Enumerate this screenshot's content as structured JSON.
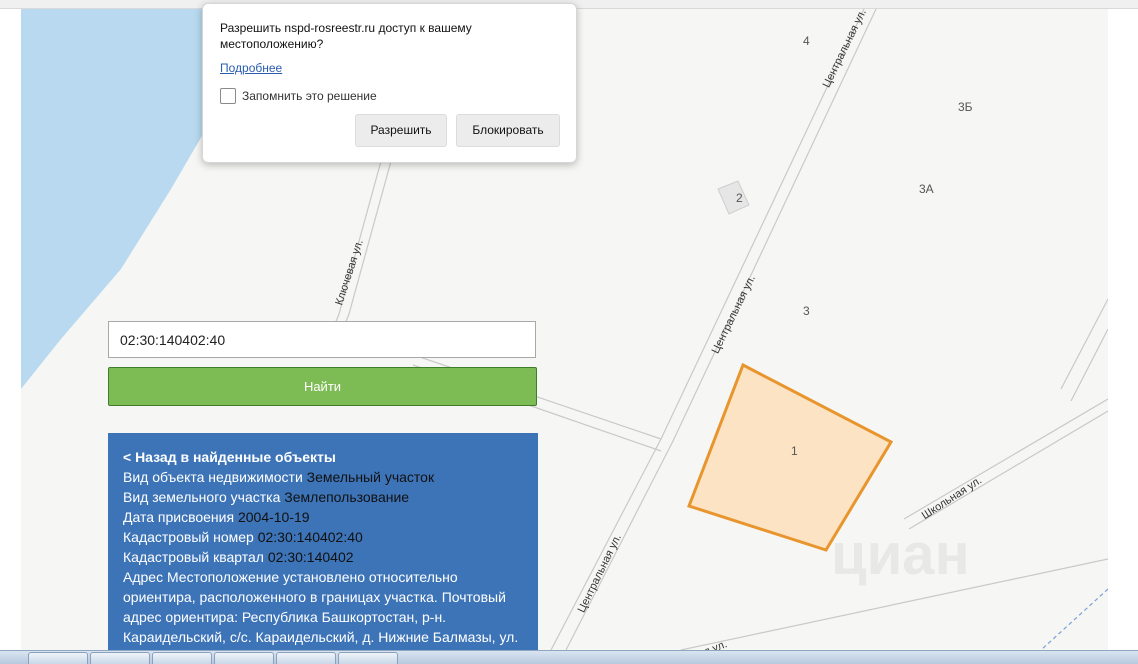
{
  "permission_prompt": {
    "message": "Разрешить nspd-rosreestr.ru доступ к вашему местоположению?",
    "more_link": "Подробнее",
    "remember_label": "Запомнить это решение",
    "allow_label": "Разрешить",
    "block_label": "Блокировать"
  },
  "search": {
    "value": "02:30:140402:40",
    "button_label": "Найти"
  },
  "map": {
    "house_numbers": [
      "4",
      "3Б",
      "2",
      "3А",
      "3",
      "1"
    ],
    "streets": {
      "central_top": "Центральная ул.",
      "central_mid": "Центральная ул.",
      "central_bottom": "Центральная ул.",
      "klyuchevaya": "Ключевая ул.",
      "shkolnaya": "Школьная ул.",
      "bottom_partial": "ая ул."
    },
    "watermark": "циан",
    "colors": {
      "water": "#b8d9ef",
      "parcel_fill": "#fce3c4",
      "parcel_stroke": "#e8952e"
    }
  },
  "info_panel": {
    "back_link": "< Назад в найденные объекты",
    "fields": [
      {
        "label": "Вид объекта недвижимости",
        "value": "Земельный участок"
      },
      {
        "label": "Вид земельного участка",
        "value": "Землепользование"
      },
      {
        "label": "Дата присвоения",
        "value": "2004-10-19"
      },
      {
        "label": "Кадастровый номер",
        "value": "02:30:140402:40"
      },
      {
        "label": "Кадастровый квартал",
        "value": "02:30:140402"
      }
    ],
    "address_label": "Адрес",
    "address_value": "Местоположение установлено относительно ориентира, расположенного в границах участка. Почтовый адрес ориентира: Республика Башкортостан, р-н. Караидельский, с/с. Караидельский, д. Нижние Балмазы, ул."
  }
}
